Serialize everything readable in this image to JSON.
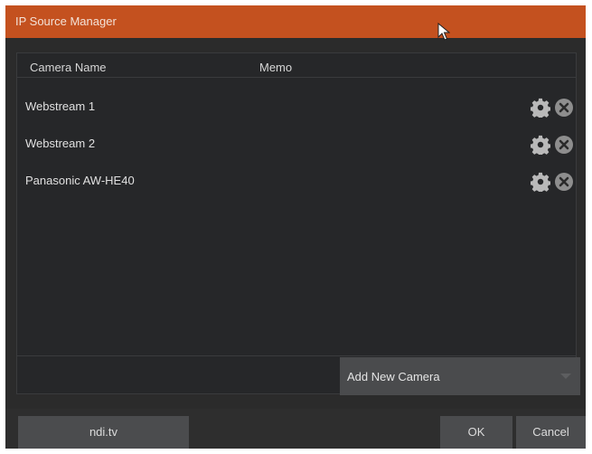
{
  "dialog": {
    "title": "IP Source Manager"
  },
  "table": {
    "headers": {
      "camera_name": "Camera Name",
      "memo": "Memo"
    },
    "rows": [
      {
        "camera_name": "Webstream 1",
        "memo": ""
      },
      {
        "camera_name": "Webstream 2",
        "memo": ""
      },
      {
        "camera_name": "Panasonic AW-HE40",
        "memo": ""
      }
    ],
    "row_icons": [
      "gear-icon",
      "close-circle-icon"
    ]
  },
  "add_camera": {
    "label": "Add New Camera"
  },
  "buttons": {
    "ndi": "ndi.tv",
    "ok": "OK",
    "cancel": "Cancel"
  },
  "colors": {
    "titlebar": "#c4511f",
    "background": "#2b2b2b",
    "panel": "#262729",
    "button": "#4b4c4e"
  }
}
